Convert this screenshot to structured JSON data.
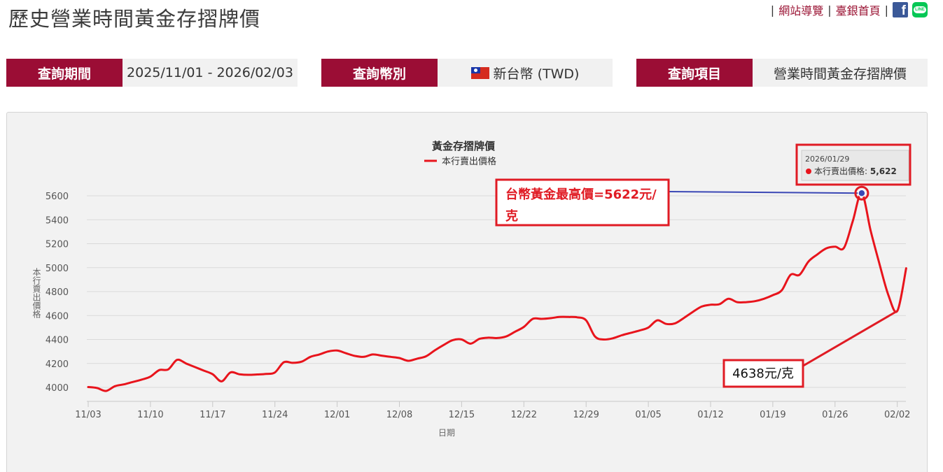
{
  "header": {
    "title": "歷史營業時間黃金存摺牌價",
    "links": {
      "sitemap": "網站導覽",
      "home": "臺銀首頁",
      "sep": "|"
    },
    "social": {
      "facebook": "f",
      "line": "LINE"
    }
  },
  "query": {
    "period_label": "查詢期間",
    "period_value": "2025/11/01 - 2026/02/03",
    "currency_label": "查詢幣別",
    "currency_value": "新台幣 (TWD)",
    "currency_flag": "taiwan-flag-icon",
    "item_label": "查詢項目",
    "item_value": "營業時間黃金存摺牌價"
  },
  "colors": {
    "brand": "#9b0d35",
    "series": "#e8141c",
    "annotation": "#e01b24",
    "connector": "#3a47b5"
  },
  "chart_data": {
    "type": "line",
    "title": "黃金存摺牌價",
    "xlabel": "日期",
    "ylabel": "本行賣出價格",
    "ylim": [
      3900,
      5700
    ],
    "yticks": [
      4000,
      4200,
      4400,
      4600,
      4800,
      5000,
      5200,
      5400,
      5600
    ],
    "xticks": [
      "11/03",
      "11/10",
      "11/17",
      "11/24",
      "12/01",
      "12/08",
      "12/15",
      "12/22",
      "12/29",
      "01/05",
      "01/12",
      "01/19",
      "01/26",
      "02/02"
    ],
    "grid": true,
    "legend_position": "top-center",
    "series": [
      {
        "name": "本行賣出價格",
        "x": [
          0,
          1,
          2,
          3,
          4,
          5,
          6,
          7,
          8,
          9,
          10,
          11,
          12,
          13,
          14,
          15,
          16,
          17,
          18,
          19,
          20,
          21,
          22,
          23,
          24,
          25,
          26,
          27,
          28,
          29,
          30,
          31,
          32,
          33,
          34,
          35,
          36,
          37,
          38,
          39,
          40,
          41,
          42,
          43,
          44,
          45,
          46,
          47,
          48,
          49,
          50,
          51,
          52,
          53,
          54,
          55,
          56,
          57,
          58,
          59,
          60,
          61,
          62,
          63,
          64,
          65,
          66,
          67,
          68,
          69,
          70,
          71,
          72,
          73,
          74,
          75,
          76,
          77,
          78,
          79,
          80,
          81,
          82,
          83,
          84,
          85,
          86,
          87,
          88,
          89,
          90,
          91,
          92
        ],
        "values": [
          4003,
          3995,
          3970,
          4010,
          4025,
          4045,
          4065,
          4090,
          4145,
          4150,
          4230,
          4200,
          4170,
          4140,
          4110,
          4050,
          4125,
          4110,
          4105,
          4108,
          4112,
          4125,
          4210,
          4205,
          4215,
          4255,
          4275,
          4300,
          4308,
          4285,
          4263,
          4255,
          4275,
          4265,
          4255,
          4245,
          4222,
          4240,
          4260,
          4310,
          4355,
          4395,
          4400,
          4365,
          4405,
          4415,
          4412,
          4425,
          4465,
          4505,
          4572,
          4572,
          4578,
          4588,
          4588,
          4585,
          4560,
          4425,
          4400,
          4410,
          4435,
          4455,
          4475,
          4500,
          4560,
          4530,
          4535,
          4580,
          4630,
          4675,
          4690,
          4695,
          4740,
          4712,
          4712,
          4720,
          4740,
          4770,
          4810,
          4940,
          4940,
          5050,
          5110,
          5160,
          5175,
          5165,
          5390,
          5622,
          5310,
          5030,
          4770,
          4638,
          4995
        ]
      }
    ],
    "tooltip": {
      "date": "2026/01/29",
      "label": "本行賣出價格:",
      "value": "5,622"
    }
  },
  "annotations": {
    "max_note_line1": "台幣黃金最高價=5622元/",
    "max_note_line2": "克",
    "min_note": "4638元/克"
  }
}
